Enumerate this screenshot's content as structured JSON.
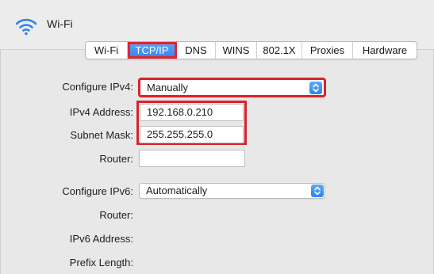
{
  "header": {
    "title": "Wi-Fi",
    "icon": "wifi-icon"
  },
  "tabs": [
    {
      "label": "Wi-Fi",
      "active": false
    },
    {
      "label": "TCP/IP",
      "active": true
    },
    {
      "label": "DNS",
      "active": false
    },
    {
      "label": "WINS",
      "active": false
    },
    {
      "label": "802.1X",
      "active": false
    },
    {
      "label": "Proxies",
      "active": false
    },
    {
      "label": "Hardware",
      "active": false
    }
  ],
  "ipv4": {
    "configure_label": "Configure IPv4:",
    "configure_value": "Manually",
    "address_label": "IPv4 Address:",
    "address_value": "192.168.0.210",
    "subnet_label": "Subnet Mask:",
    "subnet_value": "255.255.255.0",
    "router_label": "Router:",
    "router_value": ""
  },
  "ipv6": {
    "configure_label": "Configure IPv6:",
    "configure_value": "Automatically",
    "router_label": "Router:",
    "address_label": "IPv6 Address:",
    "prefix_label": "Prefix Length:"
  },
  "colors": {
    "accent": "#2f83ea",
    "highlight": "#d8232b"
  }
}
